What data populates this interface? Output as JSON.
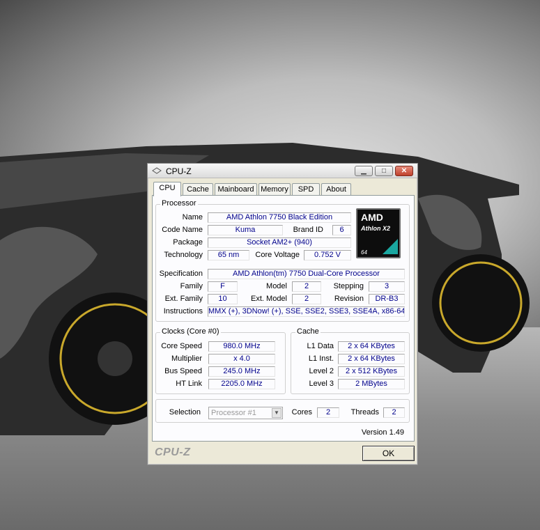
{
  "window": {
    "title": "CPU-Z",
    "brand": "CPU-Z",
    "ok_label": "OK",
    "version": "Version 1.49"
  },
  "tabs": [
    "CPU",
    "Cache",
    "Mainboard",
    "Memory",
    "SPD",
    "About"
  ],
  "processor": {
    "group_title": "Processor",
    "name_label": "Name",
    "name": "AMD Athlon 7750 Black Edition",
    "codename_label": "Code Name",
    "codename": "Kuma",
    "brandid_label": "Brand ID",
    "brandid": "6",
    "package_label": "Package",
    "package": "Socket AM2+ (940)",
    "technology_label": "Technology",
    "technology": "65 nm",
    "voltage_label": "Core Voltage",
    "voltage": "0.752 V",
    "spec_label": "Specification",
    "spec": "AMD Athlon(tm) 7750 Dual-Core Processor",
    "family_label": "Family",
    "family": "F",
    "model_label": "Model",
    "model": "2",
    "stepping_label": "Stepping",
    "stepping": "3",
    "extfamily_label": "Ext. Family",
    "extfamily": "10",
    "extmodel_label": "Ext. Model",
    "extmodel": "2",
    "revision_label": "Revision",
    "revision": "DR-B3",
    "instructions_label": "Instructions",
    "instructions": "MMX (+), 3DNow! (+), SSE, SSE2, SSE3, SSE4A, x86-64",
    "logo": {
      "brand": "AMD",
      "line": "Athlon X2",
      "bits": "64"
    }
  },
  "clocks": {
    "group_title": "Clocks (Core #0)",
    "corespeed_label": "Core Speed",
    "corespeed": "980.0 MHz",
    "multiplier_label": "Multiplier",
    "multiplier": "x 4.0",
    "busspeed_label": "Bus Speed",
    "busspeed": "245.0 MHz",
    "htlink_label": "HT Link",
    "htlink": "2205.0 MHz"
  },
  "cache": {
    "group_title": "Cache",
    "l1data_label": "L1 Data",
    "l1data": "2 x 64 KBytes",
    "l1inst_label": "L1 Inst.",
    "l1inst": "2 x 64 KBytes",
    "level2_label": "Level 2",
    "level2": "2 x 512 KBytes",
    "level3_label": "Level 3",
    "level3": "2 MBytes"
  },
  "selection": {
    "label": "Selection",
    "value": "Processor #1",
    "cores_label": "Cores",
    "cores": "2",
    "threads_label": "Threads",
    "threads": "2"
  },
  "colors": {
    "value_text": "#00008b",
    "window_bg": "#ece9d8",
    "panel_bg": "#fcfcfe"
  }
}
